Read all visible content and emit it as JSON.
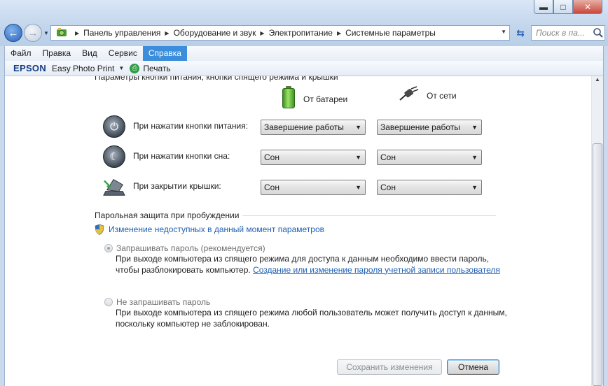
{
  "window": {
    "controls": {
      "minimize": "▬",
      "maximize": "□",
      "close": "✕"
    }
  },
  "nav": {
    "breadcrumbs": [
      "Панель управления",
      "Оборудование и звук",
      "Электропитание",
      "Системные параметры"
    ],
    "search_placeholder": "Поиск в па..."
  },
  "menu": [
    "Файл",
    "Правка",
    "Вид",
    "Сервис",
    "Справка"
  ],
  "toolbar": {
    "brand": "EPSON",
    "app": "Easy Photo Print",
    "print": "Печать"
  },
  "power": {
    "section_title_cut": "Параметры кнопки питания, кнопки спящего режима и крышки",
    "columns": {
      "battery": "От батареи",
      "ac": "От сети"
    },
    "rows": [
      {
        "label": "При нажатии кнопки питания:",
        "battery": "Завершение работы",
        "ac": "Завершение работы"
      },
      {
        "label": "При нажатии кнопки сна:",
        "battery": "Сон",
        "ac": "Сон"
      },
      {
        "label": "При закрытии крышки:",
        "battery": "Сон",
        "ac": "Сон"
      }
    ]
  },
  "password": {
    "section_title": "Парольная защита при пробуждении",
    "change_link": "Изменение недоступных в данный момент параметров",
    "require": {
      "label": "Запрашивать пароль (рекомендуется)",
      "desc_text": "При выходе компьютера из спящего режима для доступа к данным необходимо ввести пароль, чтобы разблокировать компьютер.",
      "desc_link": "Создание или изменение пароля учетной записи пользователя",
      "checked": true
    },
    "no_require": {
      "label": "Не запрашивать пароль",
      "desc_text": "При выходе компьютера из спящего режима любой пользователь может получить доступ к данным, поскольку компьютер не заблокирован.",
      "checked": false
    }
  },
  "buttons": {
    "save": "Сохранить изменения",
    "cancel": "Отмена"
  }
}
